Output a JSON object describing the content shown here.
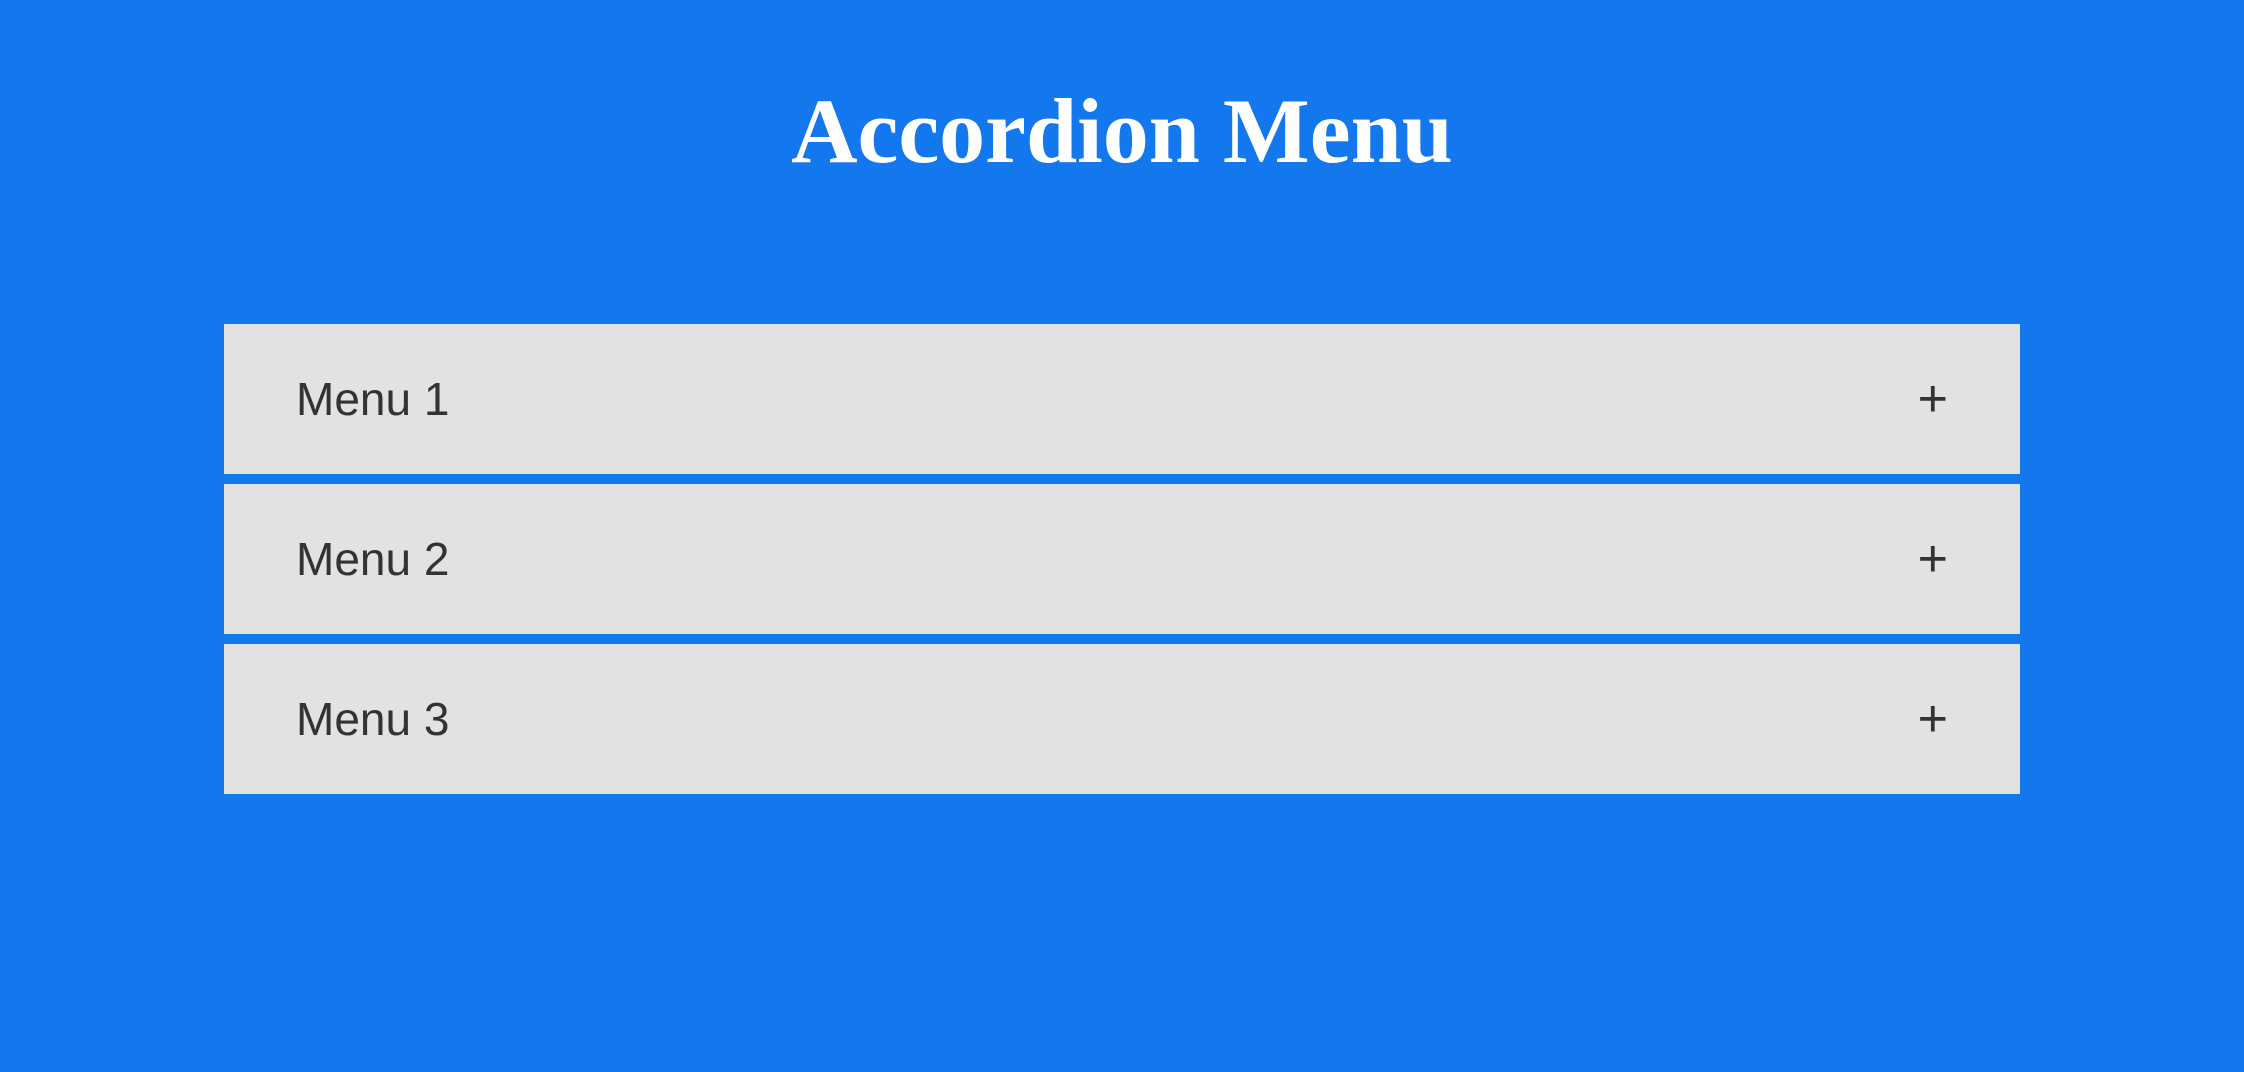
{
  "header": {
    "title": "Accordion Menu"
  },
  "accordion": {
    "items": [
      {
        "label": "Menu 1",
        "icon": "+"
      },
      {
        "label": "Menu 2",
        "icon": "+"
      },
      {
        "label": "Menu 3",
        "icon": "+"
      }
    ]
  }
}
